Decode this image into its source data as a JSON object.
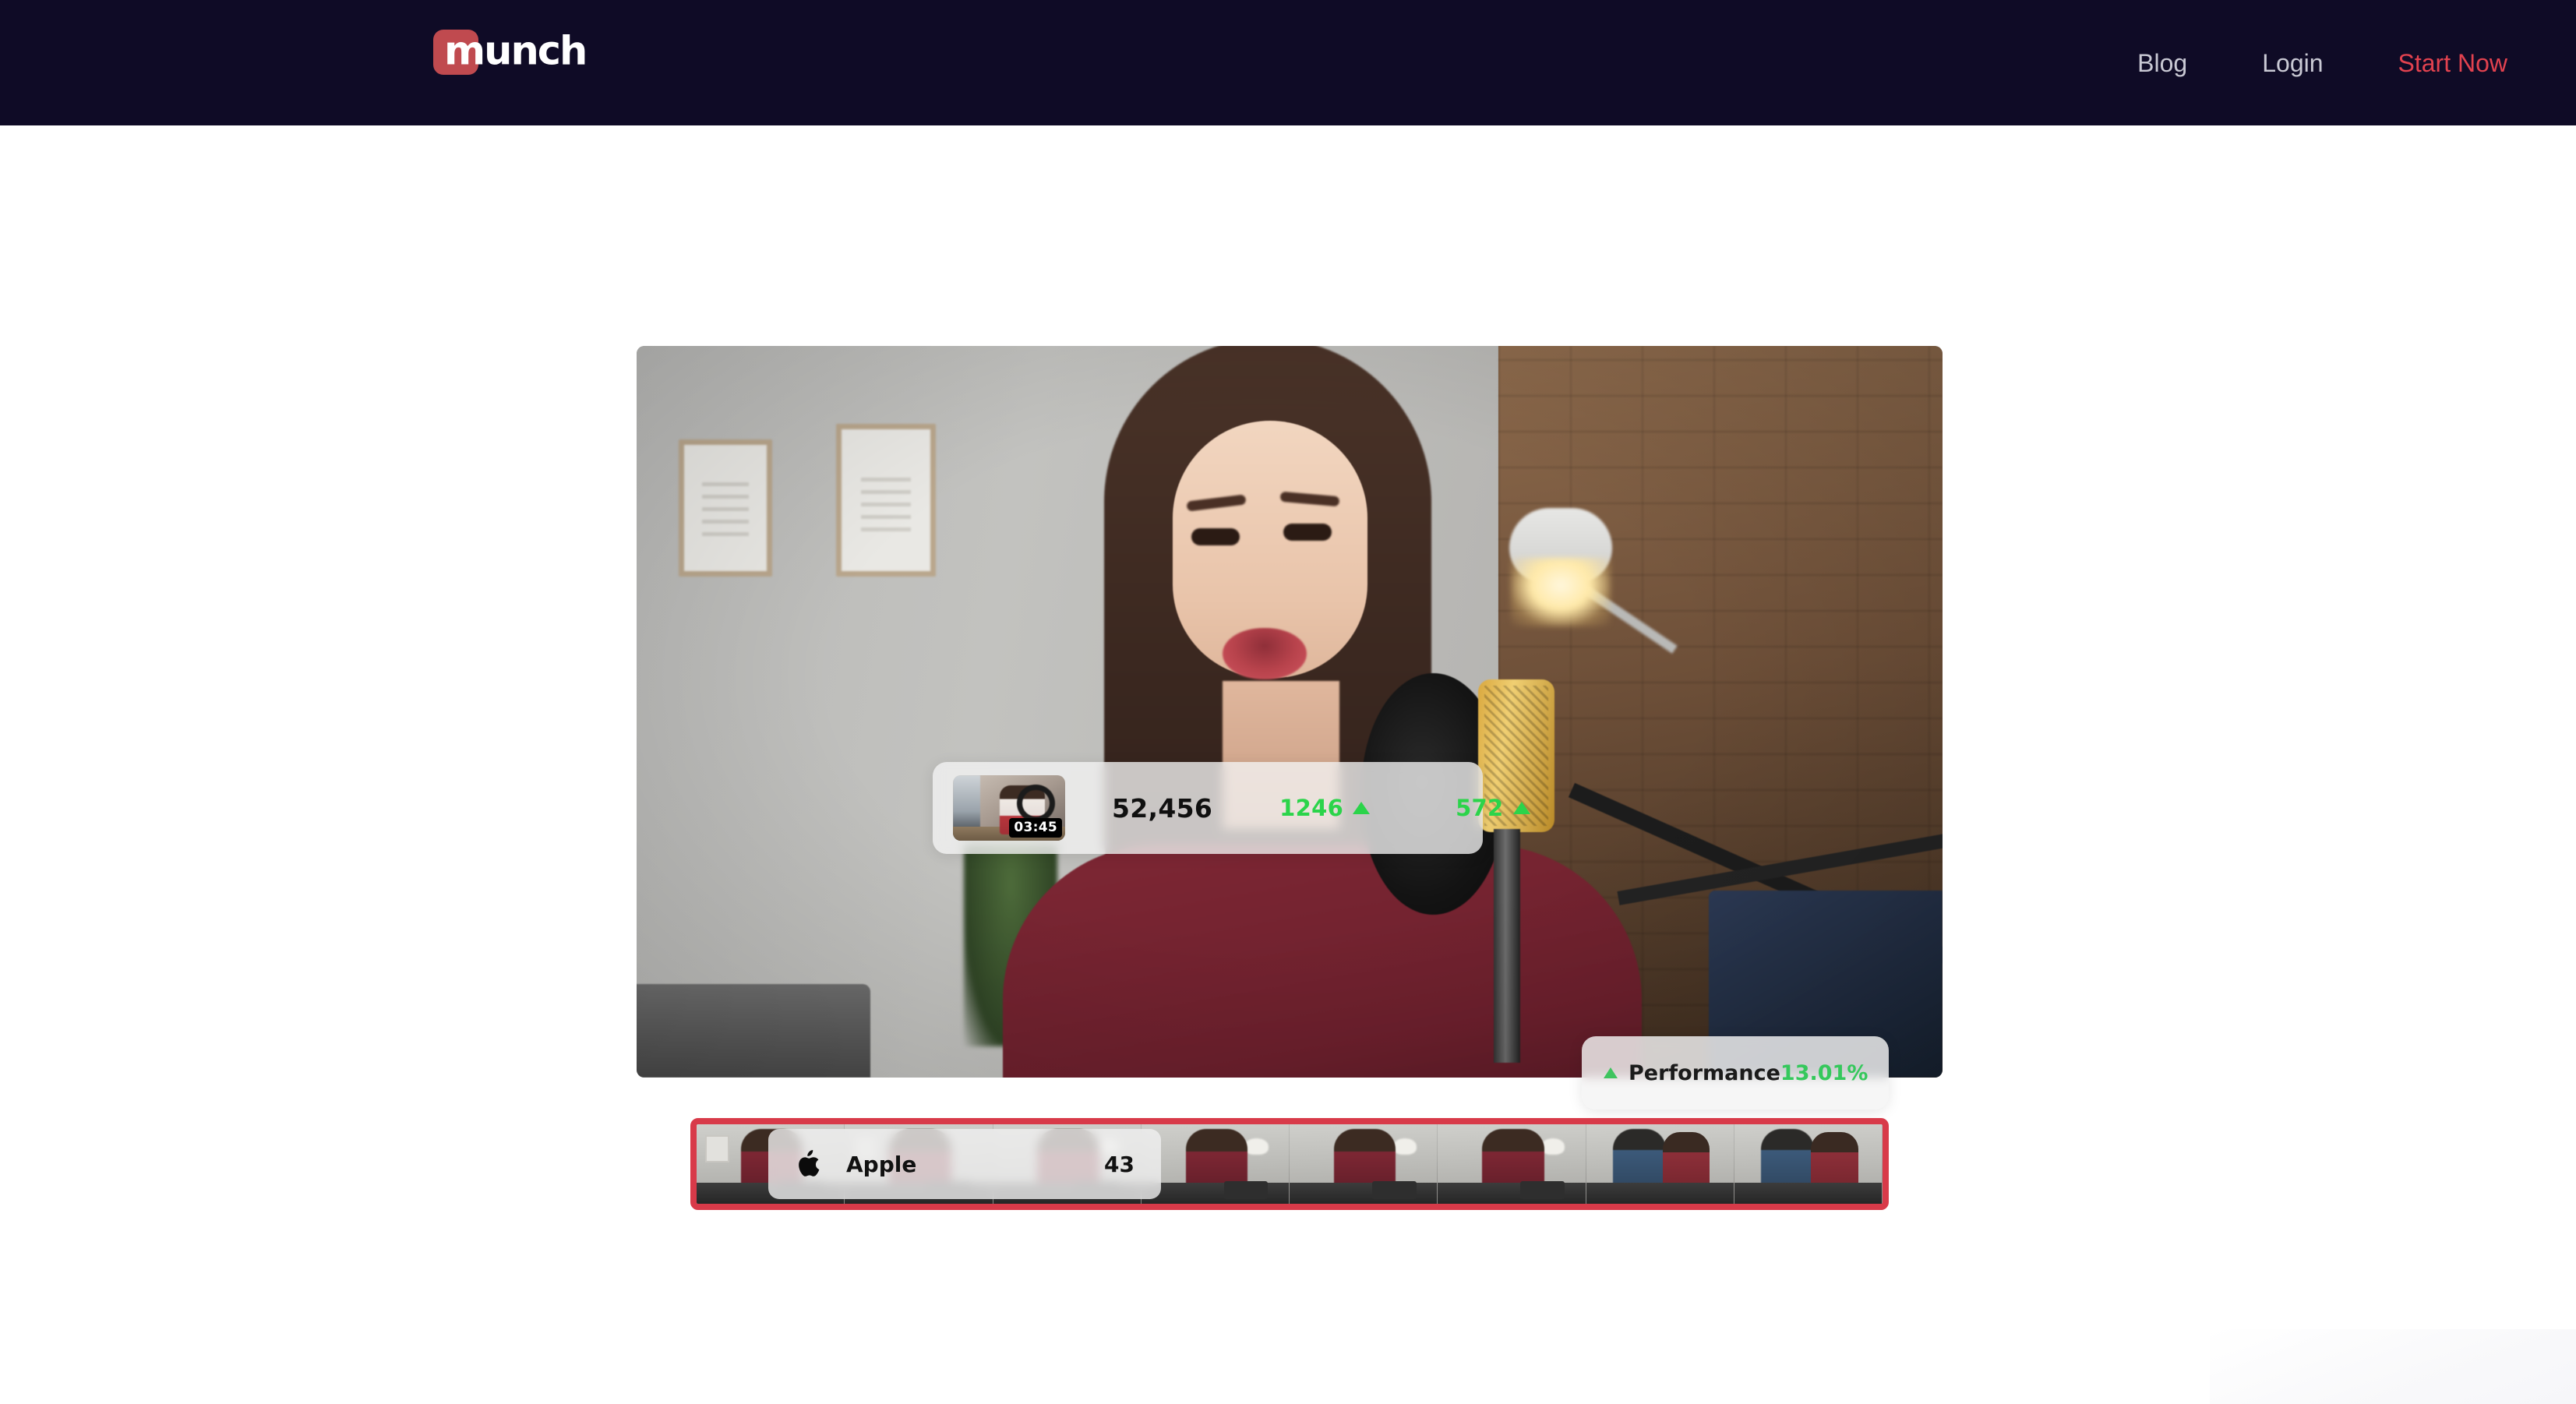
{
  "theme": {
    "header_bg": "#0F0B26",
    "page_bg": "#FFFFFF",
    "brand_red": "#C04A4F",
    "cta_red": "#E2424F",
    "nav_text": "#C9C9D4",
    "accent_green": "#2BD44A",
    "filmstrip_border": "#D83A49"
  },
  "header": {
    "brand": {
      "wordmark": "munch",
      "mark_name": "munch-logo-tile"
    },
    "nav": [
      {
        "label": "Blog",
        "name": "nav-link-blog",
        "style": "plain"
      },
      {
        "label": "Login",
        "name": "nav-link-login",
        "style": "plain"
      },
      {
        "label": "Start Now",
        "name": "nav-cta-start-now",
        "style": "cta"
      }
    ]
  },
  "hero": {
    "video": {
      "alt": "Woman speaking into a studio microphone at a desk",
      "stats_card": {
        "thumbnail_timestamp": "03:45",
        "views": "52,456",
        "metric_one": "1246",
        "metric_one_trend": "up",
        "metric_two": "572",
        "metric_two_trend": "up"
      },
      "performance_card": {
        "trend": "up",
        "label": "Performance",
        "value": "13.01%"
      }
    },
    "timeline": {
      "clip_chip": {
        "icon": "apple-logo-icon",
        "label": "Apple",
        "count": "43"
      },
      "clip_count": 8
    }
  }
}
